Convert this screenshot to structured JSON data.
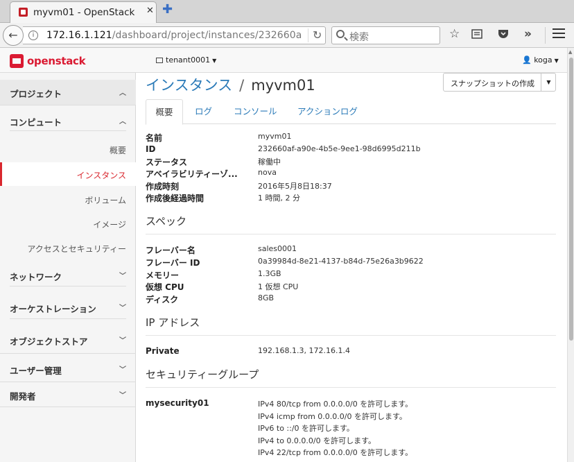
{
  "browser": {
    "tab_title": "myvm01 - OpenStack",
    "tab_close": "✕",
    "new_tab": "✚",
    "url_host": "172.16.1.121",
    "url_path": "/dashboard/project/instances/232660a",
    "search_placeholder": "検索",
    "info_glyph": "i",
    "reload_glyph": "↻",
    "back_glyph": "←"
  },
  "header": {
    "logo_text": "openstack",
    "tenant": "tenant0001",
    "user": "koga"
  },
  "sidebar": {
    "project": "プロジェクト",
    "compute": "コンピュート",
    "compute_items": [
      "概要",
      "インスタンス",
      "ボリューム",
      "イメージ",
      "アクセスとセキュリティー"
    ],
    "network": "ネットワーク",
    "orchestration": "オーケストレーション",
    "object_store": "オブジェクトストア",
    "user_admin": "ユーザー管理",
    "developer": "開発者"
  },
  "main": {
    "breadcrumb_link": "インスタンス",
    "breadcrumb_sep": "/",
    "instance_name": "myvm01",
    "snapshot_button": "スナップショットの作成",
    "tabs": [
      "概要",
      "ログ",
      "コンソール",
      "アクションログ"
    ],
    "overview": [
      {
        "k": "名前",
        "v": "myvm01"
      },
      {
        "k": "ID",
        "v": "232660af-a90e-4b5e-9ee1-98d6995d211b"
      },
      {
        "k": "ステータス",
        "v": "稼働中"
      },
      {
        "k": "アベイラビリティーゾ...",
        "v": "nova"
      },
      {
        "k": "作成時刻",
        "v": "2016年5月8日18:37"
      },
      {
        "k": "作成後経過時間",
        "v": "1 時間, 2 分"
      }
    ],
    "spec_title": "スペック",
    "spec": [
      {
        "k": "フレーバー名",
        "v": "sales0001"
      },
      {
        "k": "フレーバー ID",
        "v": "0a39984d-8e21-4137-b84d-75e26a3b9622"
      },
      {
        "k": "メモリー",
        "v": "1.3GB"
      },
      {
        "k": "仮想 CPU",
        "v": "1 仮想 CPU"
      },
      {
        "k": "ディスク",
        "v": "8GB"
      }
    ],
    "ip_title": "IP アドレス",
    "ip": {
      "k": "Private",
      "v": "192.168.1.3,  172.16.1.4"
    },
    "sg_title": "セキュリティーグループ",
    "sg_name": "mysecurity01",
    "sg_rules": [
      "IPv4 80/tcp from 0.0.0.0/0 を許可します。",
      "IPv4 icmp from 0.0.0.0/0 を許可します。",
      "IPv6 to ::/0 を許可します。",
      "IPv4 to 0.0.0.0/0 を許可します。",
      "IPv4 22/tcp from 0.0.0.0/0 を許可します。"
    ]
  }
}
